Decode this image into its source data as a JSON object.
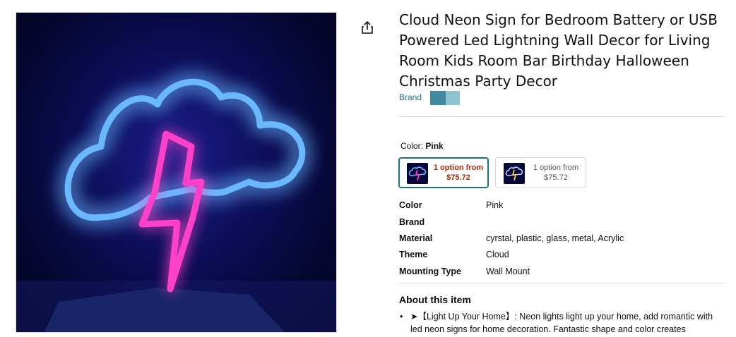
{
  "product": {
    "title": "Cloud Neon Sign for Bedroom Battery or USB Powered Led Lightning Wall Decor for Living Room Kids Room Bar Birthday Halloween Christmas Party Decor",
    "brand_label": "Brand",
    "brand_blur_colors": [
      "#3f8aa0",
      "#8cc4cf"
    ]
  },
  "variation": {
    "label": "Color:",
    "selected": "Pink",
    "options": [
      {
        "line1": "1 option from",
        "line2": "$75.72",
        "selected": true
      },
      {
        "line1": "1 option from",
        "line2": "$75.72",
        "selected": false
      }
    ]
  },
  "specs": [
    {
      "key": "Color",
      "value": "Pink"
    },
    {
      "key": "Brand",
      "value": ""
    },
    {
      "key": "Material",
      "value": "cyrstal, plastic, glass, metal, Acrylic"
    },
    {
      "key": "Theme",
      "value": "Cloud"
    },
    {
      "key": "Mounting Type",
      "value": "Wall Mount"
    }
  ],
  "about": {
    "title": "About this item",
    "bullet_marker": "•",
    "bullets": [
      "➤【Light Up Your Home】: Neon lights light up your home, add romantic with led neon signs for home decoration. Fantastic shape and color creates"
    ]
  },
  "colors": {
    "neon_blue": "#6ab8ff",
    "neon_pink": "#ff3fc8",
    "link": "#1f6f84",
    "price_red": "#b12704"
  },
  "icons": {
    "share": "share-icon"
  }
}
